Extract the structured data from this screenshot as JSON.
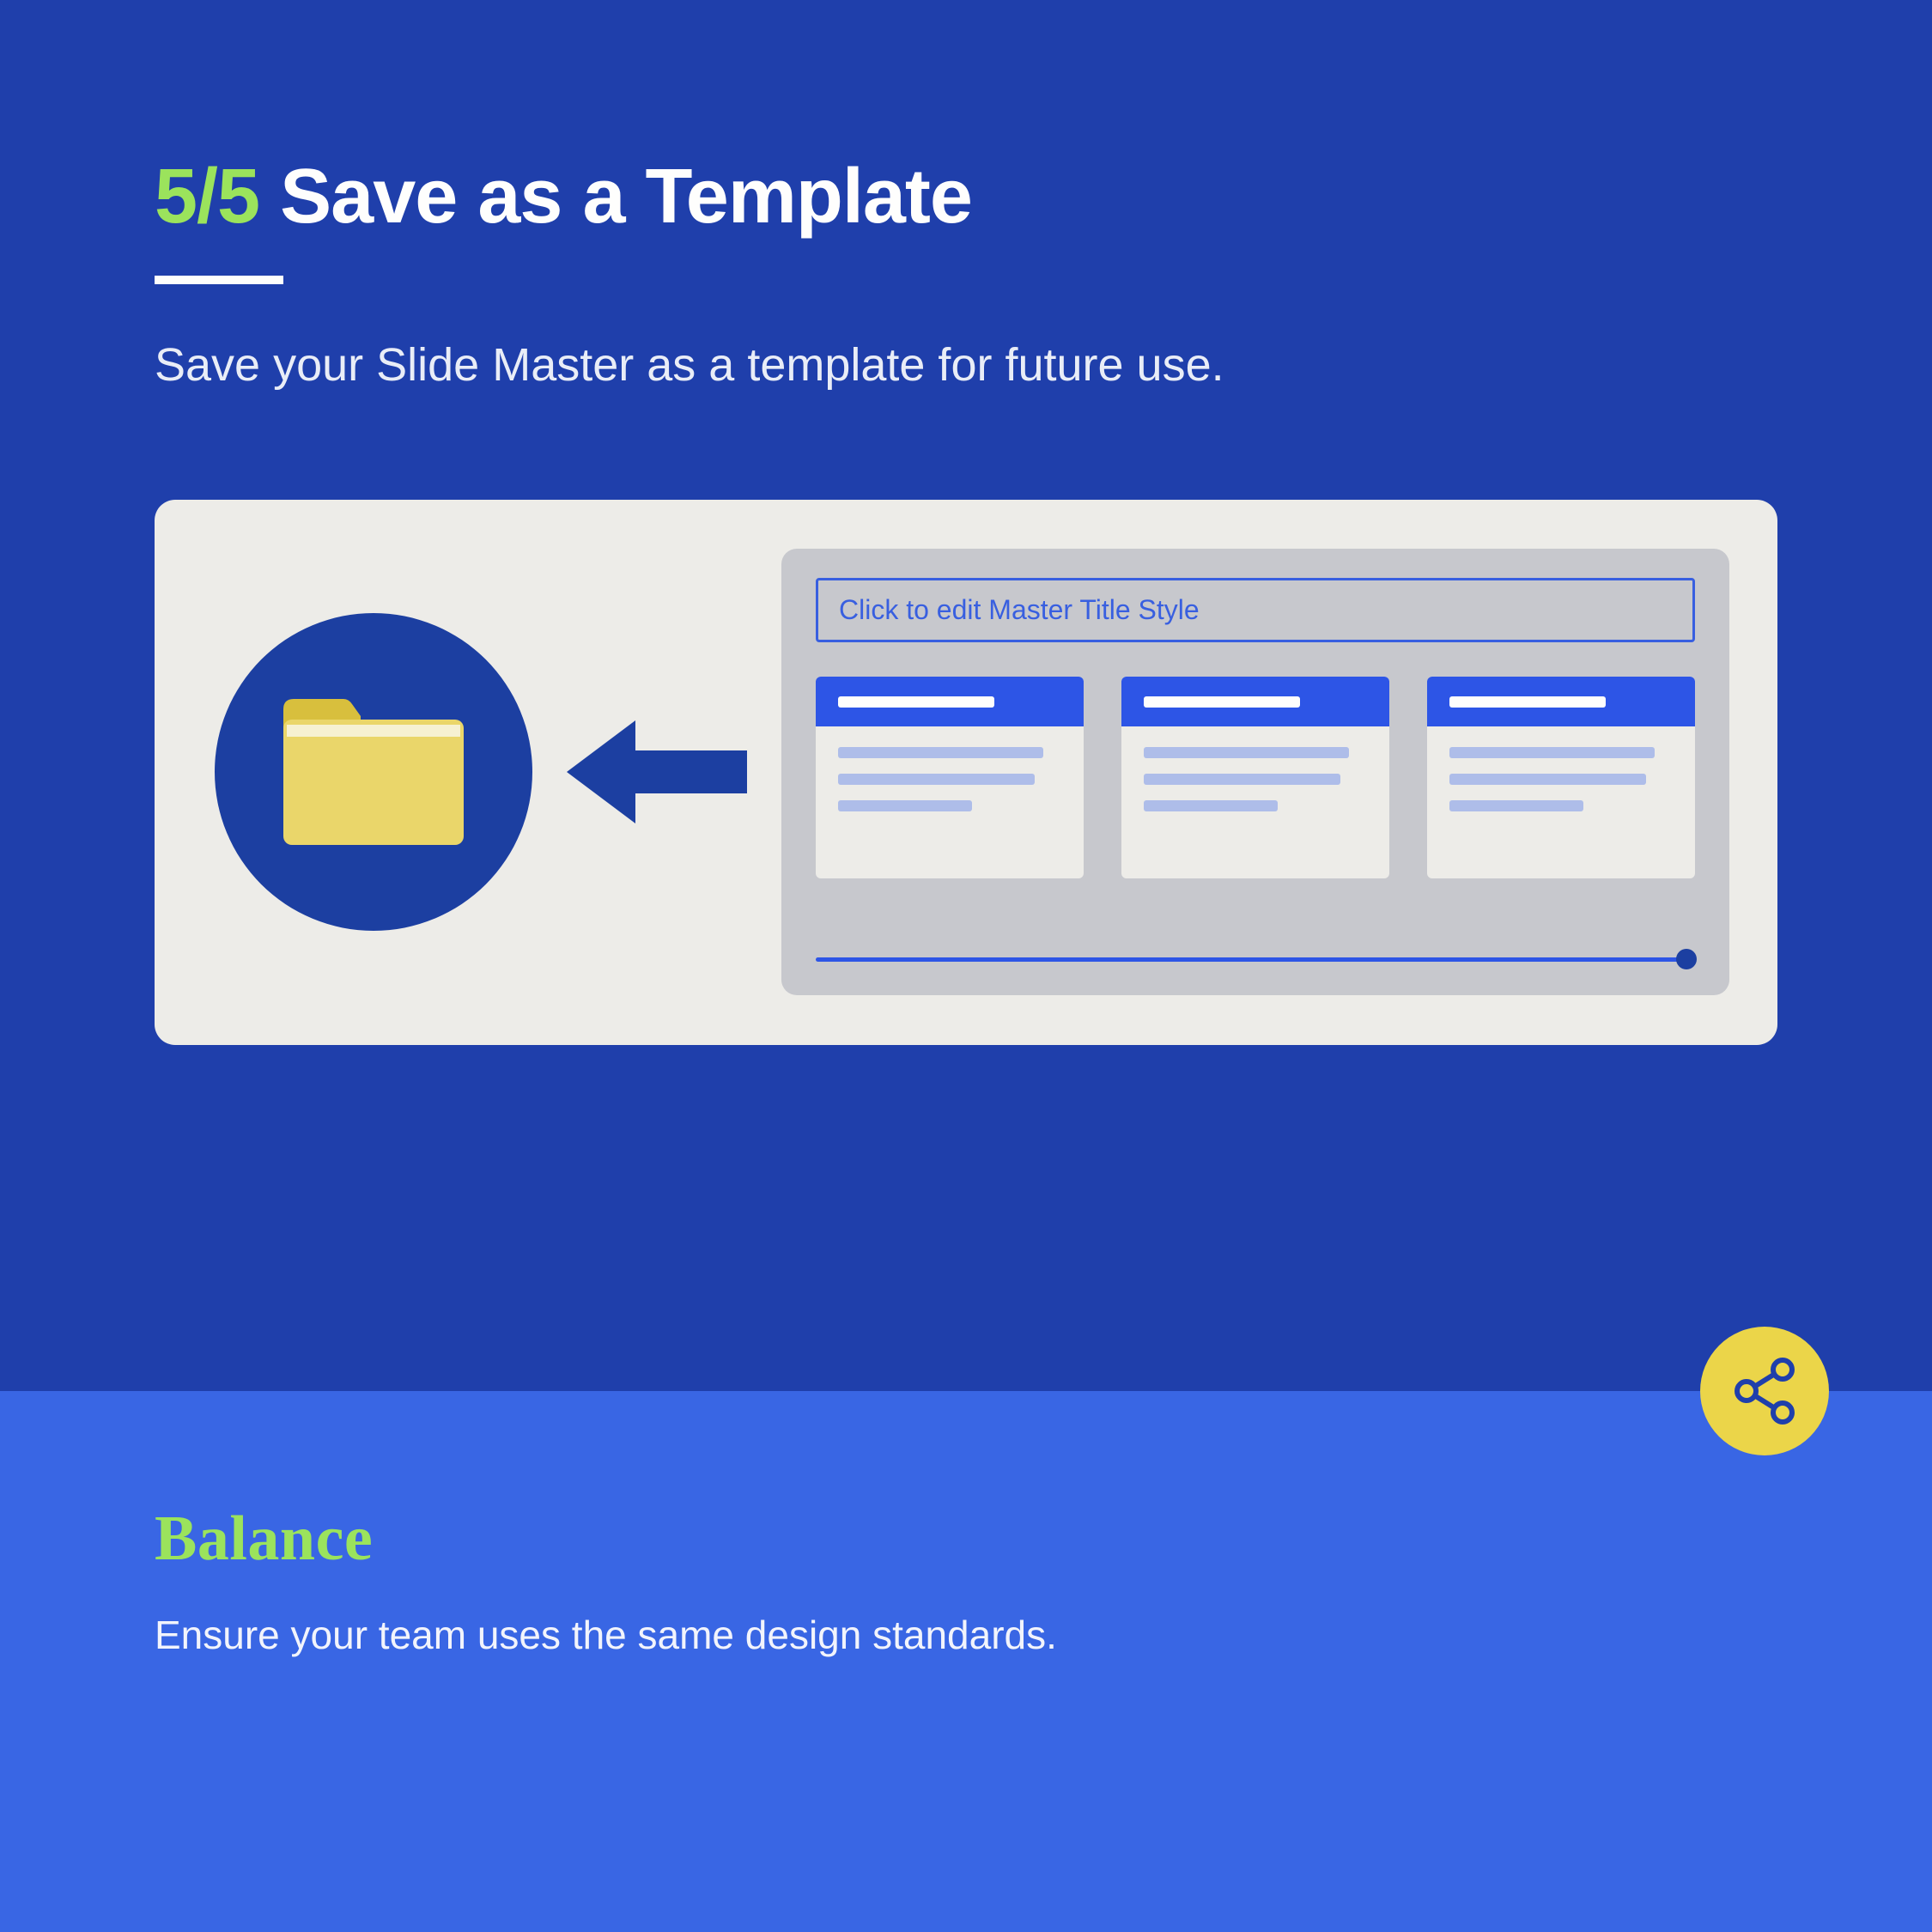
{
  "header": {
    "step": "5/5",
    "title": "Save as a Template",
    "subtitle": "Save your Slide Master as a template for future use."
  },
  "illustration": {
    "master_title_placeholder": "Click to edit Master Title Style"
  },
  "footer": {
    "title": "Balance",
    "subtitle": "Ensure your team uses the same design standards."
  }
}
